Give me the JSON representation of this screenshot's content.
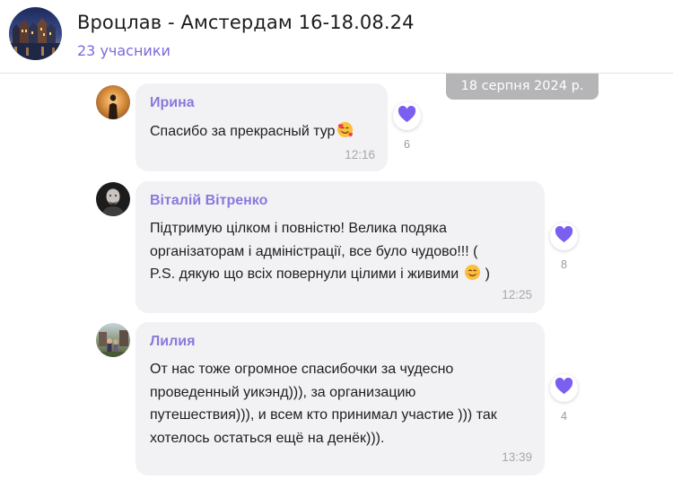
{
  "header": {
    "title": "Вроцлав - Амстердам 16-18.08.24",
    "members": "23 учасники"
  },
  "date_divider": "18 серпня 2024 р.",
  "messages": [
    {
      "sender": "Ирина",
      "lines": [
        "Спасибо за прекрасный тур"
      ],
      "emoji": "smiling-face-with-hearts",
      "time": "12:16",
      "reaction": {
        "icon": "purple-heart-icon",
        "count": "6"
      }
    },
    {
      "sender": "Віталій Вітренко",
      "lines": [
        "Підтримую цілком і повністю! Велика подяка",
        "організаторам і адміністрації, все було чудово!!! (",
        "P.S. дякую що всіх повернули цілими і живими"
      ],
      "last_line_suffix": " )",
      "emoji": "smiling-face-with-smiling-eyes",
      "time": "12:25",
      "reaction": {
        "icon": "purple-heart-icon",
        "count": "8"
      }
    },
    {
      "sender": "Лилия",
      "lines": [
        "От нас тоже огромное спасибочки за чудесно",
        "проведенный уикэнд))), за организацию",
        "путешествия))), и всем кто принимал участие ))) так",
        "хотелось остаться ещё на денёк)))."
      ],
      "time": "13:39",
      "reaction": {
        "icon": "purple-heart-icon",
        "count": "4"
      }
    }
  ],
  "colors": {
    "accent": "#7a6cdb",
    "sender": "#8a78dd",
    "heart": "#7b5ff0",
    "bubble": "#f2f2f4",
    "date_pill": "#b5b5b8"
  }
}
